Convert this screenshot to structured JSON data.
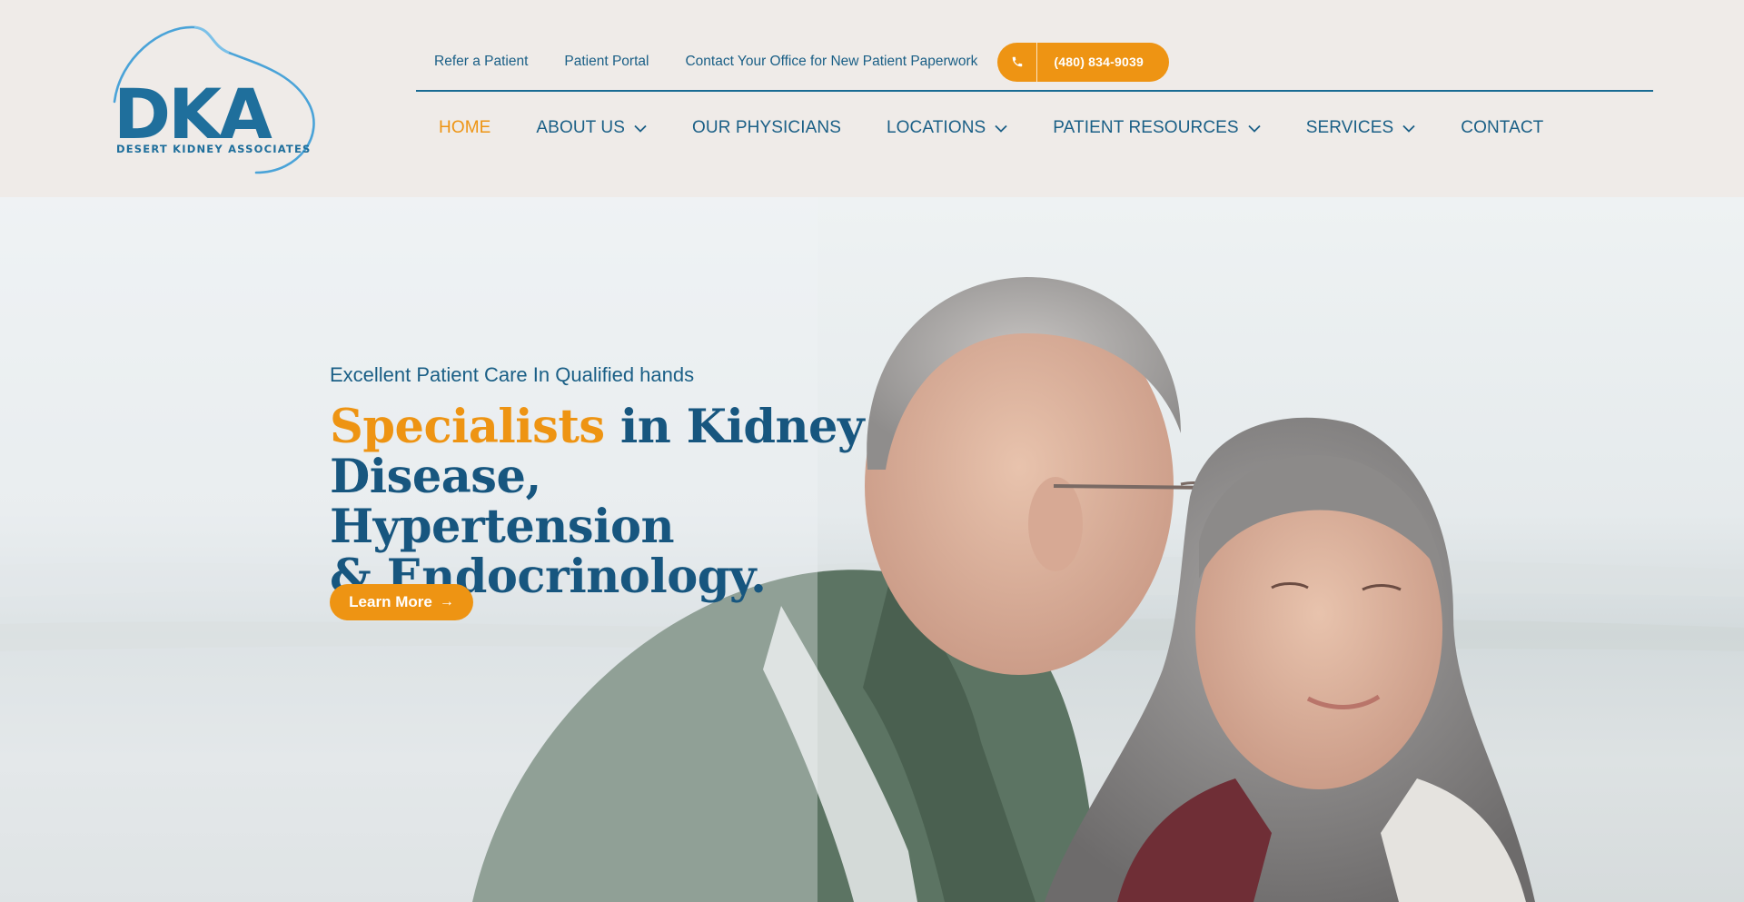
{
  "logo": {
    "letters": "DKA",
    "tagline": "DESERT KIDNEY ASSOCIATES"
  },
  "utility_nav": {
    "links": [
      "Refer a Patient",
      "Patient Portal",
      "Contact Your Office for New Patient Paperwork"
    ],
    "phone": "(480) 834-9039"
  },
  "main_nav": {
    "items": [
      {
        "label": "HOME",
        "active": true,
        "dropdown": false
      },
      {
        "label": "ABOUT US",
        "active": false,
        "dropdown": true
      },
      {
        "label": "OUR PHYSICIANS",
        "active": false,
        "dropdown": false
      },
      {
        "label": "LOCATIONS",
        "active": false,
        "dropdown": true
      },
      {
        "label": "PATIENT RESOURCES",
        "active": false,
        "dropdown": true
      },
      {
        "label": "SERVICES",
        "active": false,
        "dropdown": true
      },
      {
        "label": "CONTACT",
        "active": false,
        "dropdown": false
      }
    ]
  },
  "hero": {
    "eyebrow": "Excellent Patient Care In Qualified hands",
    "headline_highlight": "Specialists",
    "headline_line1_rest": " in Kidney",
    "headline_line2": "Disease, Hypertension",
    "headline_line3": "& Endocrinology.",
    "cta_label": "Learn More"
  },
  "colors": {
    "brand_blue": "#1a5f86",
    "accent_orange": "#ee9413",
    "header_bg": "#efebe8"
  }
}
